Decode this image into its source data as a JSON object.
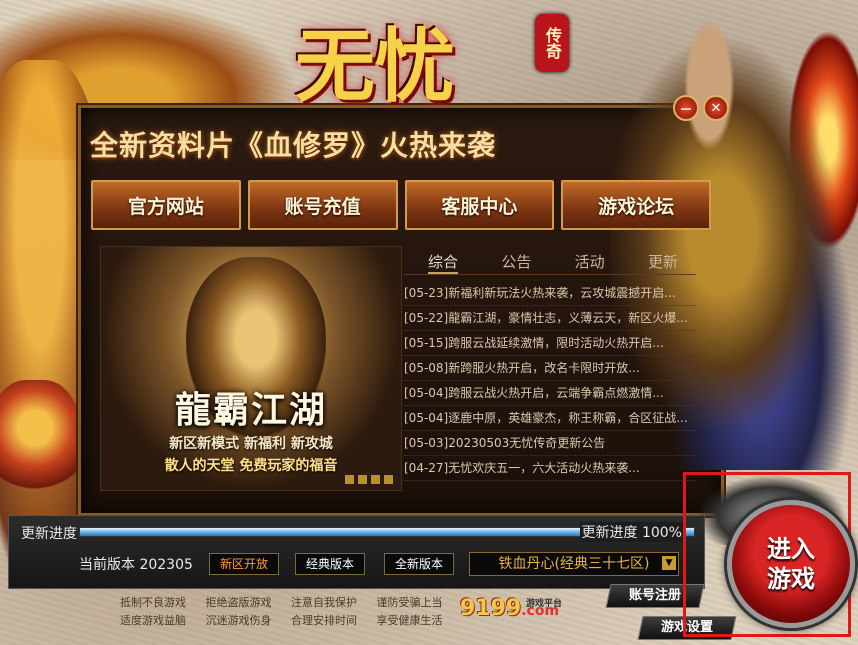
{
  "logo": {
    "main": "无忧",
    "seal": "传奇"
  },
  "banner": "全新资料片《血修罗》火热来袭",
  "hero_controls": {
    "minimize": "－",
    "close": "✕"
  },
  "nav": [
    "官方网站",
    "账号充值",
    "客服中心",
    "游戏论坛"
  ],
  "promo": {
    "title": "龍霸江湖",
    "line1": "新区新模式  新福利  新攻城",
    "line2": "散人的天堂  免费玩家的福音"
  },
  "news": {
    "tabs": [
      "综合",
      "公告",
      "活动",
      "更新"
    ],
    "active_tab": "综合",
    "items": [
      "[05-23]新福利新玩法火热来袭，云攻城震撼开启...",
      "[05-22]龍霸江湖，豪情壮志，义薄云天，新区火爆...",
      "[05-15]跨服云战延续激情，限时活动火热开启...",
      "[05-08]新跨服火热开启，改名卡限时开放...",
      "[05-04]跨服云战火热开启，云端争霸点燃激情...",
      "[05-04]逐鹿中原，英雄豪杰，称王称霸，合区征战...",
      "[05-03]20230503无忧传奇更新公告",
      "[04-27]无忧欢庆五一，六大活动火热来袭..."
    ]
  },
  "update": {
    "label": "更新进度",
    "percent_text": "更新进度 100%",
    "progress": 1.0
  },
  "version": {
    "label": "当前版本 202305",
    "buttons": [
      "新区开放",
      "经典版本",
      "全新版本"
    ],
    "active": "新区开放",
    "server": "铁血丹心(经典三十七区)",
    "arrow": "▼"
  },
  "notice": [
    "抵制不良游戏",
    "拒绝盗版游戏",
    "注意自我保护",
    "谨防受骗上当",
    "适度游戏益脑",
    "沉迷游戏伤身",
    "合理安排时间",
    "享受健康生活"
  ],
  "platform": {
    "num": "9199",
    "com": ".com",
    "sub": "游戏平台"
  },
  "footer_buttons": {
    "register": "账号注册",
    "settings": "游戏设置"
  },
  "enter": {
    "line1": "进入",
    "line2": "游戏"
  },
  "colors": {
    "accent": "#c26a27",
    "highlight": "#e01818",
    "progress": "#6db3e8"
  }
}
